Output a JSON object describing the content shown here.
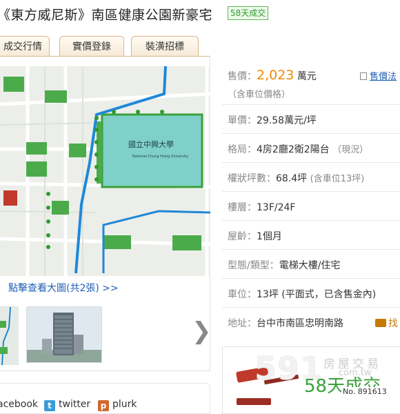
{
  "title": {
    "text": "《東方威尼斯》南區健康公園新豪宅",
    "badge": "58天成交"
  },
  "tabs": [
    "成交行情",
    "實價登錄",
    "裝潢招標"
  ],
  "map": {
    "campus_name": "國立中興大學",
    "campus_name_en": "National Chung Hsing University",
    "link": "點擊查看大圖(共2張) >>"
  },
  "share": {
    "facebook": "acebook",
    "twitter": "twitter",
    "plurk": "plurk"
  },
  "info": {
    "price_label": "售價：",
    "price_value": "2,023",
    "price_unit": "萬元",
    "price_note": "（含車位價格）",
    "price_link": "售價法",
    "unit_price_label": "單價：",
    "unit_price_value": "29.58萬元/坪",
    "layout_label": "格局：",
    "layout_value": "4房2廳2衛2陽台",
    "layout_note": "（現況）",
    "area_label": "權狀坪數：",
    "area_value": "68.4坪",
    "area_note": "(含車位13坪)",
    "floor_label": "樓層：",
    "floor_value": "13F/24F",
    "age_label": "屋齡：",
    "age_value": "1個月",
    "type_label": "型態/類型：",
    "type_value": "電梯大樓/住宅",
    "parking_label": "車位：",
    "parking_value": "13坪 (平面式，已含售金內)",
    "address_label": "地址：",
    "address_value": "台中市南區忠明南路",
    "address_link": "找"
  },
  "promo": {
    "brand_num": "591",
    "brand_text": "房屋交易",
    "brand_domain": "com.tw",
    "headline": "58天成交",
    "case_no": "No. 891613"
  },
  "colors": {
    "accent_orange": "#f08a00",
    "badge_green": "#2e9a2e",
    "link_blue": "#1f5fb5",
    "promo_red": "#c0392b"
  }
}
